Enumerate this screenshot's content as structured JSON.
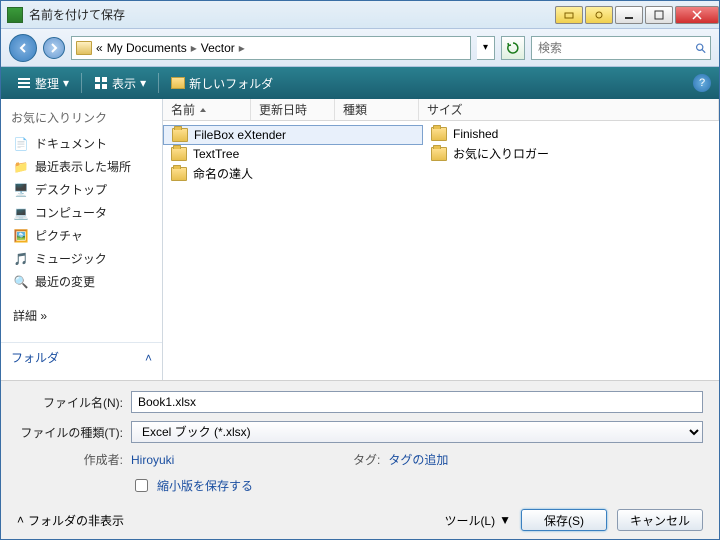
{
  "window": {
    "title": "名前を付けて保存"
  },
  "breadcrumb": {
    "prefix": "«",
    "parts": [
      "My Documents",
      "Vector"
    ]
  },
  "search": {
    "placeholder": "検索"
  },
  "toolbar": {
    "organize": "整理",
    "view": "表示",
    "newfolder": "新しいフォルダ"
  },
  "sidebar": {
    "heading": "お気に入りリンク",
    "items": [
      {
        "label": "ドキュメント",
        "icon": "document-icon"
      },
      {
        "label": "最近表示した場所",
        "icon": "recent-icon"
      },
      {
        "label": "デスクトップ",
        "icon": "desktop-icon"
      },
      {
        "label": "コンピュータ",
        "icon": "computer-icon"
      },
      {
        "label": "ピクチャ",
        "icon": "pictures-icon"
      },
      {
        "label": "ミュージック",
        "icon": "music-icon"
      },
      {
        "label": "最近の変更",
        "icon": "search-icon"
      }
    ],
    "details": "詳細 »",
    "folders": "フォルダ"
  },
  "columns": {
    "name": "名前",
    "date": "更新日時",
    "type": "種類",
    "size": "サイズ"
  },
  "files": {
    "left": [
      "FileBox eXtender",
      "TextTree",
      "命名の達人"
    ],
    "right": [
      "Finished",
      "お気に入りロガー"
    ]
  },
  "form": {
    "filename_label": "ファイル名(N):",
    "filename_value": "Book1.xlsx",
    "filetype_label": "ファイルの種類(T):",
    "filetype_value": "Excel ブック (*.xlsx)",
    "author_label": "作成者:",
    "author_value": "Hiroyuki",
    "tag_label": "タグ:",
    "tag_value": "タグの追加",
    "thumbnail": "縮小版を保存する",
    "hide_folders": "フォルダの非表示",
    "tools": "ツール(L)",
    "save": "保存(S)",
    "cancel": "キャンセル"
  }
}
